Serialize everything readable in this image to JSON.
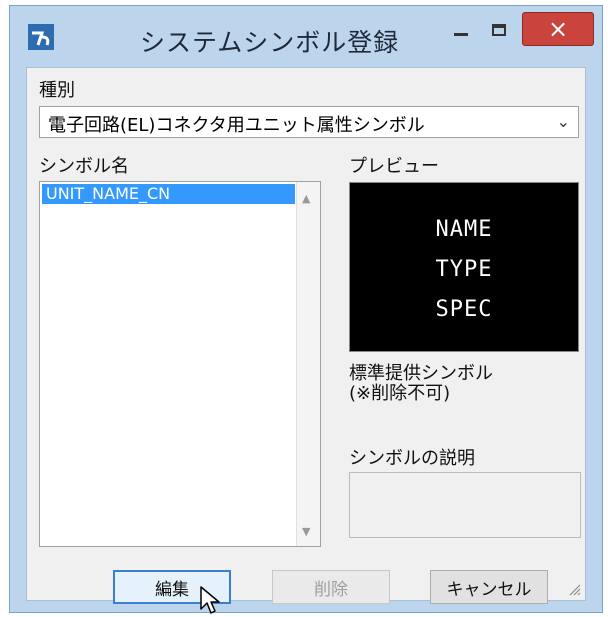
{
  "window": {
    "title": "システムシンボル登録",
    "close_glyph": "×",
    "colors": {
      "frame": "#bcd4ec",
      "close": "#c9443d",
      "selection": "#3399ff",
      "preview_bg": "#000000"
    }
  },
  "type_label": "種別",
  "type_combo": {
    "value": "電子回路(EL)コネクタ用ユニット属性シンボル",
    "arrow_glyph": "⌄"
  },
  "symbol_name_label": "シンボル名",
  "symbol_list": {
    "items": [
      "UNIT_NAME_CN"
    ],
    "selected_index": 0
  },
  "preview_label": "プレビュー",
  "preview": {
    "lines": [
      "NAME",
      "TYPE",
      "SPEC"
    ]
  },
  "standard_note": {
    "line1": "標準提供シンボル",
    "line2": "(※削除不可)"
  },
  "description_label": "シンボルの説明",
  "description_value": "",
  "buttons": {
    "edit": "編集",
    "delete": "削除",
    "cancel": "キャンセル"
  },
  "icons": [
    "app-icon",
    "minimize-icon",
    "maximize-icon",
    "close-icon",
    "chevron-down-icon",
    "scroll-up-icon",
    "scroll-down-icon",
    "mouse-cursor-icon",
    "resize-grip-icon"
  ]
}
